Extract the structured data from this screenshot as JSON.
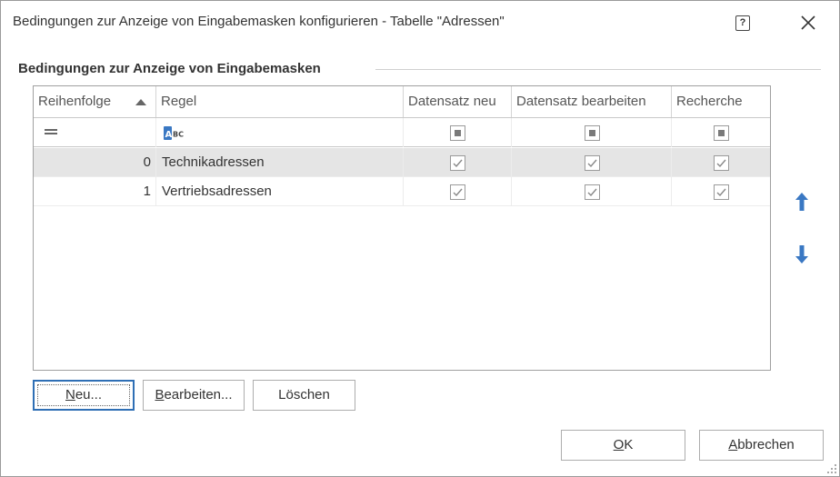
{
  "window": {
    "title": "Bedingungen zur Anzeige von Eingabemasken konfigurieren - Tabelle \"Adressen\"",
    "help_icon_text": "?"
  },
  "group": {
    "label": "Bedingungen zur Anzeige von Eingabemasken"
  },
  "grid": {
    "columns": [
      "Reihenfolge",
      "Regel",
      "Datensatz neu",
      "Datensatz bearbeiten",
      "Recherche"
    ],
    "sort_column": "Reihenfolge",
    "sort_direction": "ascending",
    "filter_row": {
      "reihenfolge_icon": "equals-icon",
      "regel_icon": "abc-text-filter-icon",
      "checkbox_state": "indeterminate"
    },
    "rows": [
      {
        "reihenfolge": "0",
        "regel": "Technikadressen",
        "datensatz_neu": true,
        "datensatz_bearbeiten": true,
        "recherche": true,
        "selected": true
      },
      {
        "reihenfolge": "1",
        "regel": "Vertriebsadressen",
        "datensatz_neu": true,
        "datensatz_bearbeiten": true,
        "recherche": true,
        "selected": false
      }
    ]
  },
  "buttons": {
    "neu": {
      "prefix": "",
      "accel": "N",
      "rest": "eu..."
    },
    "bearbeiten": {
      "prefix": "",
      "accel": "B",
      "rest": "earbeiten..."
    },
    "loeschen": {
      "label": "Löschen"
    },
    "ok": {
      "prefix": "",
      "accel": "O",
      "rest": "K"
    },
    "abbrechen": {
      "prefix": "",
      "accel": "A",
      "rest": "bbrechen"
    }
  },
  "icons": {
    "move_up": "arrow-up-icon",
    "move_down": "arrow-down-icon",
    "close": "close-icon",
    "help": "help-icon"
  },
  "colors": {
    "accent_blue": "#2f6fb5",
    "selected_row": "#e5e5e5",
    "arrow_blue": "#3a78c3"
  }
}
